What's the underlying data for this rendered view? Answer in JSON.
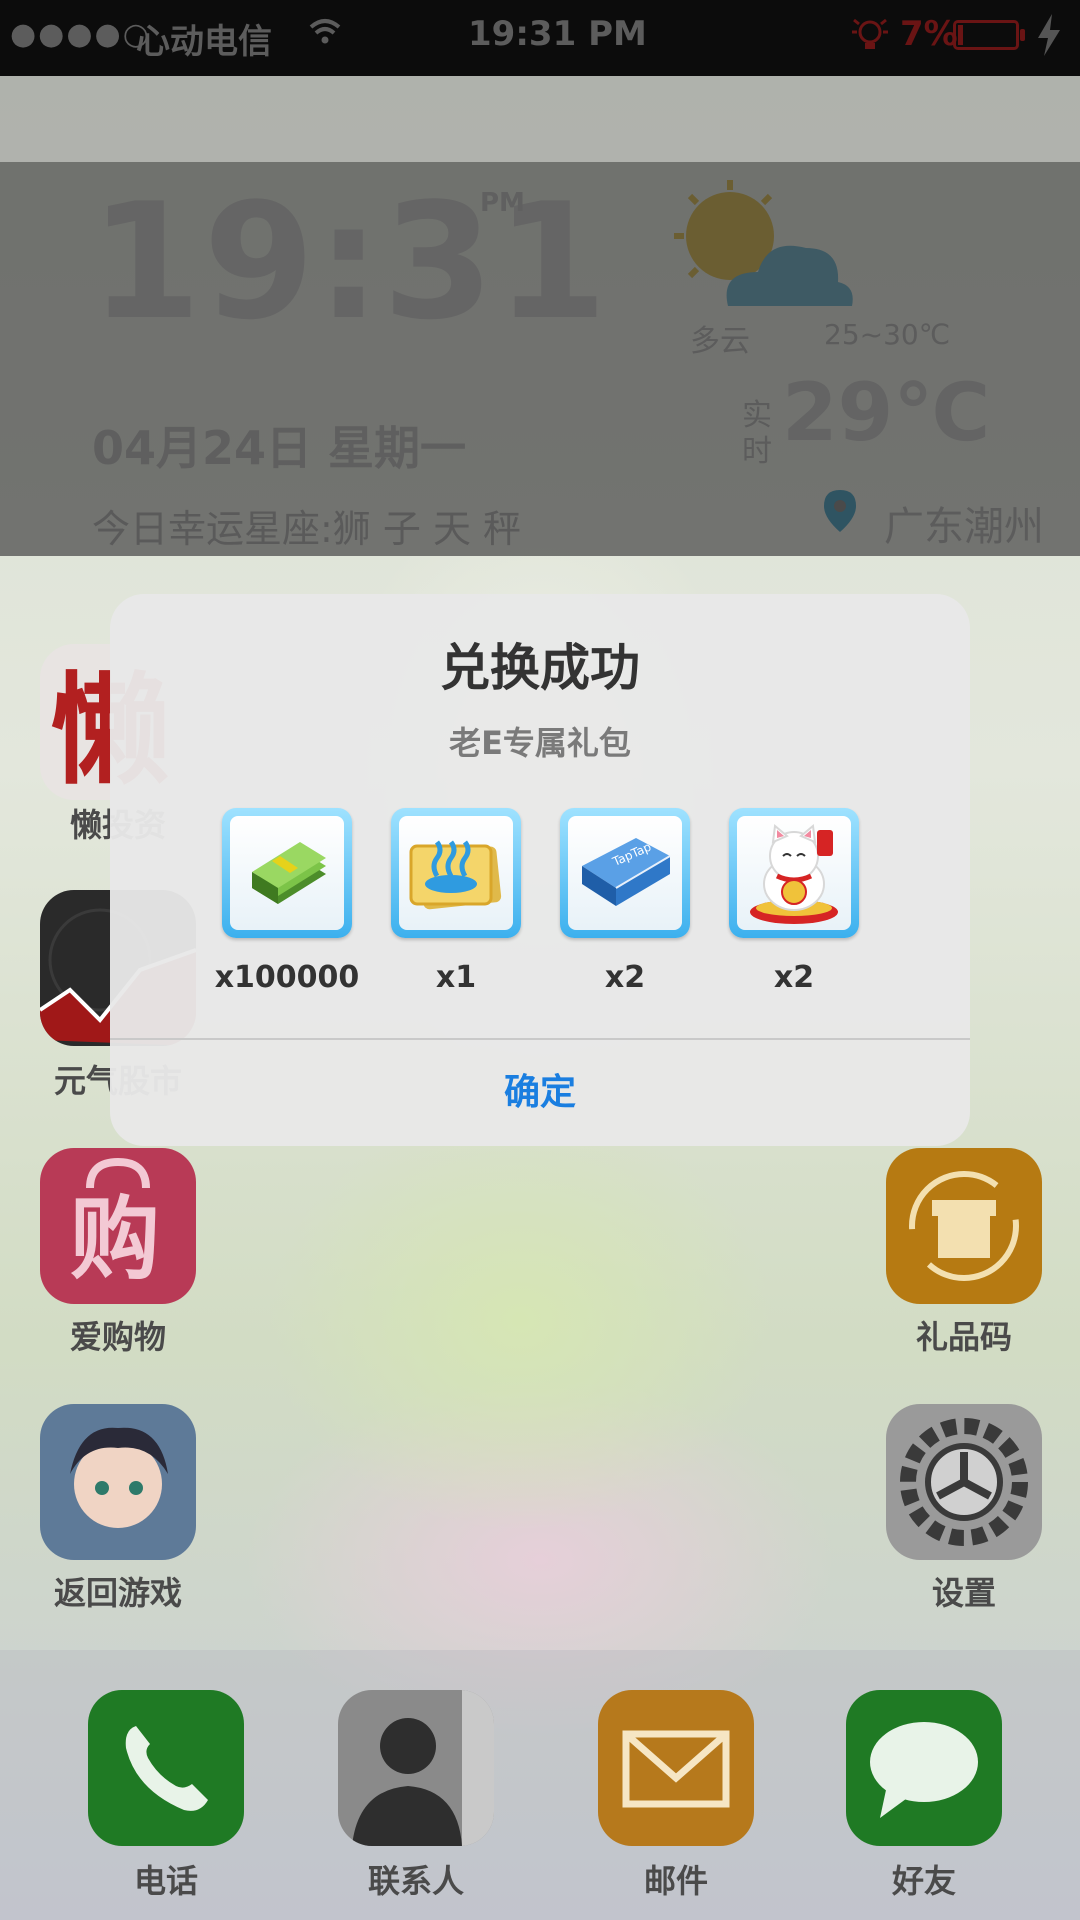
{
  "status_bar": {
    "signal": "●●●●○",
    "carrier": "心动电信",
    "wifi_icon": "wifi-icon",
    "time": "19:31 PM",
    "battery_percent": "7%",
    "charging_icon": "lightning-icon"
  },
  "widget": {
    "time": "19:31",
    "ampm": "PM",
    "date": "04月24日  星期一",
    "lucky_sign": "今日幸运星座:狮 子  天 秤",
    "weather_icon": "partly-cloudy-icon",
    "weather": "多云",
    "temp_range": "25~30℃",
    "realtime_label": "实时",
    "current_temp": "29℃",
    "location_icon": "location-pin-icon",
    "location": "广东潮州"
  },
  "apps": {
    "lazy_invest": "懒投资",
    "stock": "元气股市",
    "shopping": "爱购物",
    "gift_code": "礼品码",
    "back_game": "返回游戏",
    "settings": "设置"
  },
  "dock": {
    "phone": "电话",
    "contacts": "联系人",
    "mail": "邮件",
    "friends": "好友"
  },
  "dialog": {
    "title": "兑换成功",
    "subtitle": "老E专属礼包",
    "items": [
      {
        "icon": "cash-bundle-icon",
        "quantity": "x100000"
      },
      {
        "icon": "hot-spring-ticket-icon",
        "quantity": "x1"
      },
      {
        "icon": "taptap-book-icon",
        "quantity": "x2"
      },
      {
        "icon": "lucky-cat-icon",
        "quantity": "x2"
      }
    ],
    "confirm_label": "确定"
  },
  "colors": {
    "accent": "#1a7ee0",
    "slot_border": "#3cb0ee",
    "battery_low": "#6a1414"
  }
}
